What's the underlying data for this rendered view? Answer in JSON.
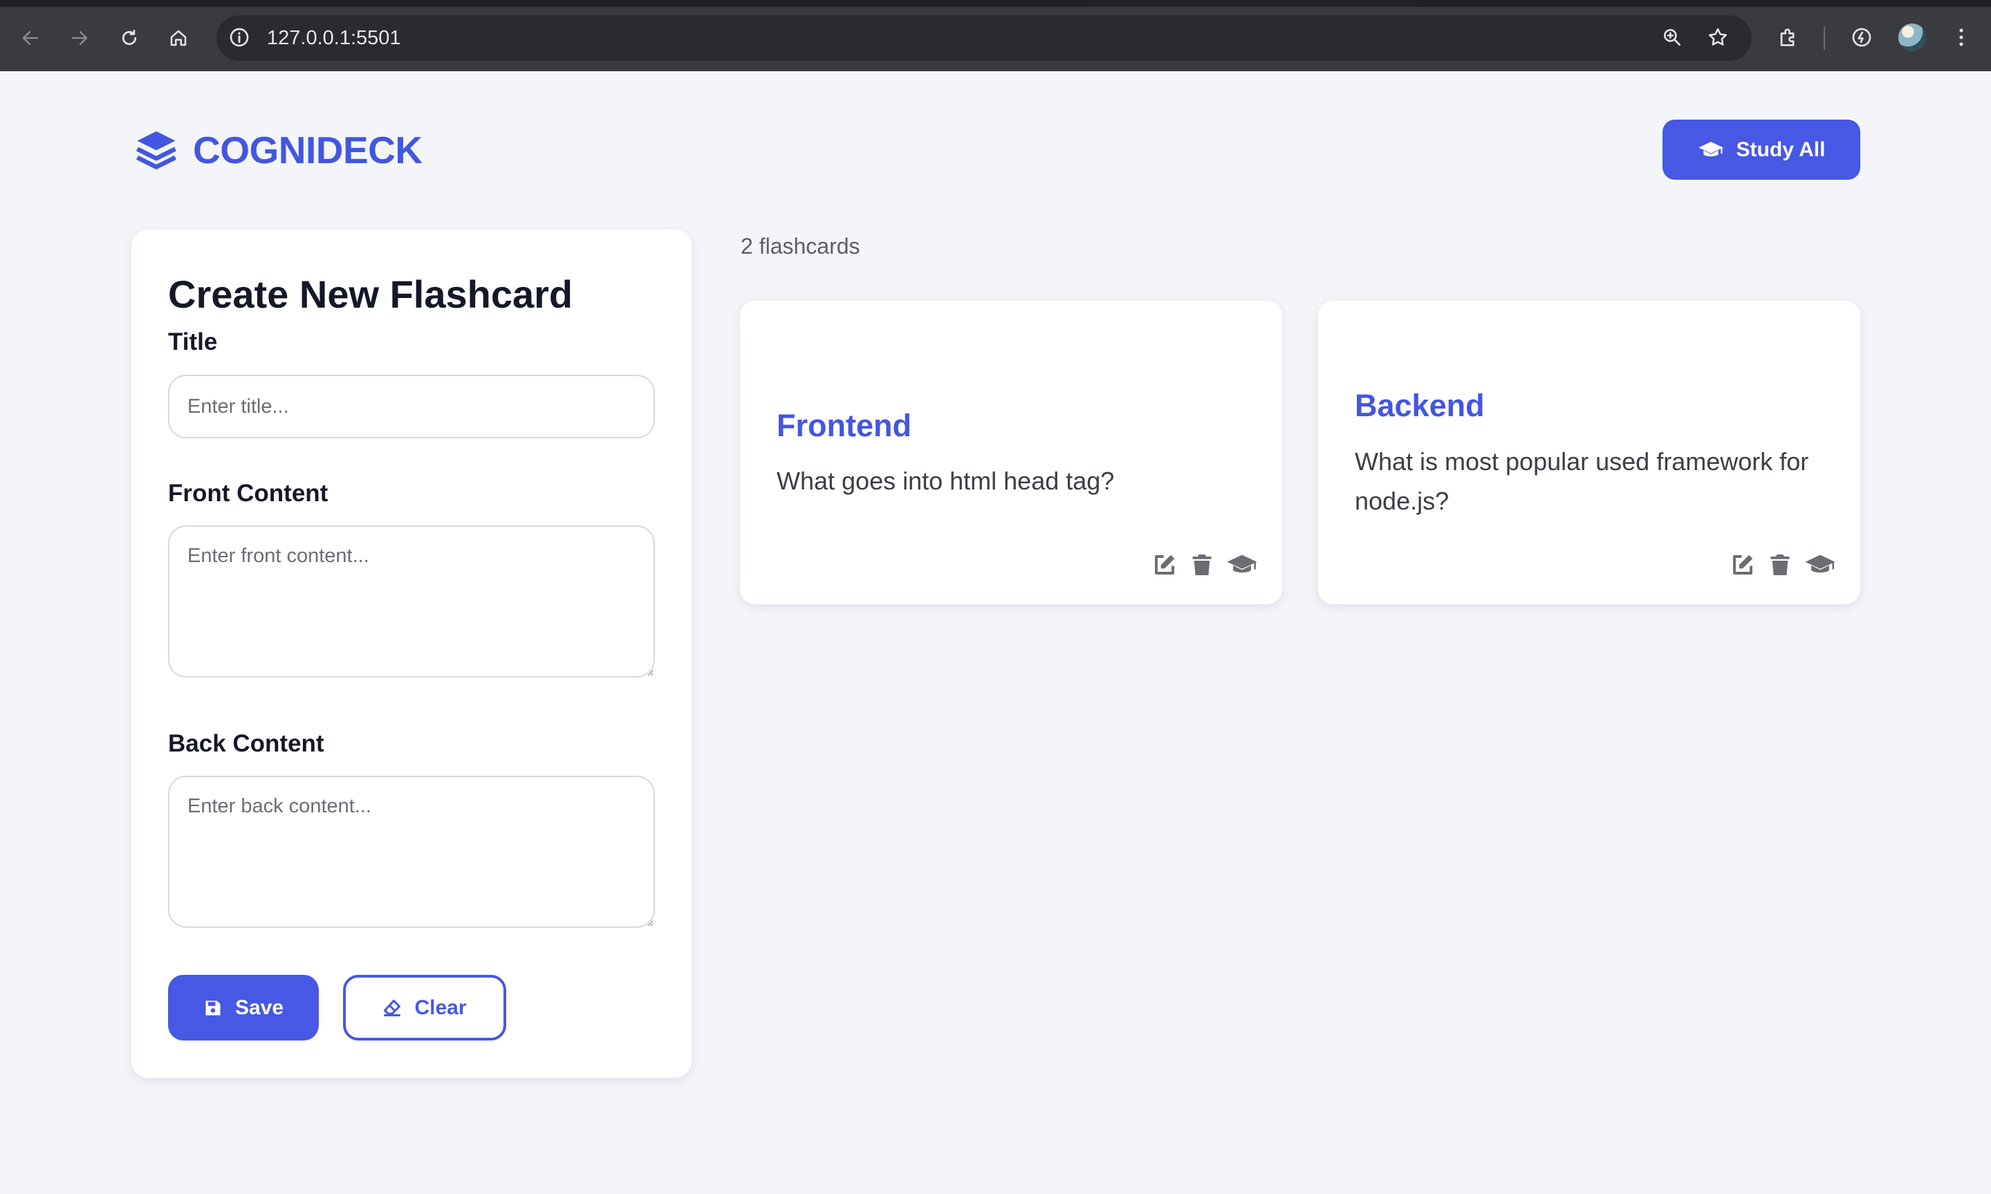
{
  "browser": {
    "url": "127.0.0.1:5501",
    "icons": [
      "back-icon",
      "forward-icon",
      "reload-icon",
      "home-icon",
      "site-info-icon",
      "zoom-icon",
      "bookmark-star-icon",
      "extensions-icon",
      "performance-icon",
      "profile-avatar"
    ]
  },
  "header": {
    "brand": "COGNIDECK",
    "study_all_label": "Study All"
  },
  "form": {
    "title": "Create New Flashcard",
    "title_label": "Title",
    "title_placeholder": "Enter title...",
    "front_label": "Front Content",
    "front_placeholder": "Enter front content...",
    "back_label": "Back Content",
    "back_placeholder": "Enter back content...",
    "save_label": "Save",
    "clear_label": "Clear"
  },
  "list": {
    "count_text": "2 flashcards",
    "cards": [
      {
        "title": "Frontend",
        "text": "What goes into html head tag?"
      },
      {
        "title": "Backend",
        "text": "What is most popular used framework for node.js?"
      }
    ]
  },
  "colors": {
    "accent": "#4658e4",
    "brand": "#4356e0",
    "page_bg": "#f4f5f9",
    "icon_gray": "#6b6d73"
  }
}
